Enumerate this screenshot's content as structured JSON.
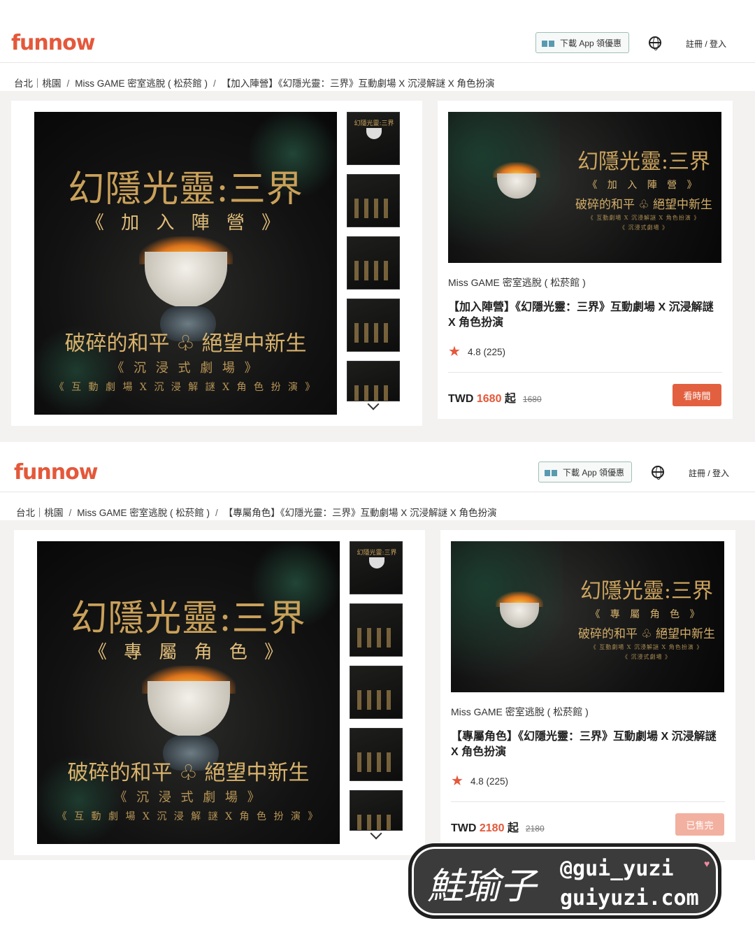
{
  "brand": {
    "logo_text": "funnow",
    "accent": "#e4583b"
  },
  "header": {
    "app_button_label": "下載 App 領優惠",
    "globe_icon": "globe-icon",
    "login_label": "註冊 / 登入"
  },
  "listings": [
    {
      "breadcrumb": {
        "city": "台北｜桃園",
        "venue": "Miss GAME 密室逃脫 ( 松菸館 )",
        "product": "【加入陣營】《幻隱光靈：三界》互動劇場 X 沉浸解謎 X 角色扮演"
      },
      "poster": {
        "title": "幻隱光靈:三界",
        "subtitle": "《 加 入 陣 營 》",
        "line3": "破碎的和平 ♧ 絕望中新生",
        "line4": "《 沉 浸 式 劇 場 》",
        "line5": "《 互 動 劇 場  X  沉 浸 解 謎  X  角 色 扮 演 》"
      },
      "info_art": {
        "title": "幻隱光靈:三界",
        "subtitle": "《 加 入 陣 營 》",
        "line3": "破碎的和平 ♧ 絕望中新生",
        "line4": "《 互動劇場 X 沉浸解謎 X 角色扮演 》",
        "line5": "《 沉浸式劇場 》"
      },
      "venue": "Miss GAME 密室逃脫 ( 松菸館 )",
      "title": "【加入陣營】《幻隱光靈：三界》互動劇場 X 沉浸解謎 X 角色扮演",
      "rating": "4.8 (225)",
      "price_prefix": "TWD ",
      "price": "1680",
      "price_suffix": " 起",
      "original_price": "1680",
      "button_label": "看時間",
      "button_state": "active"
    },
    {
      "breadcrumb": {
        "city": "台北｜桃園",
        "venue": "Miss GAME 密室逃脫 ( 松菸館 )",
        "product": "【專屬角色】《幻隱光靈：三界》互動劇場 X 沉浸解謎 X 角色扮演"
      },
      "poster": {
        "title": "幻隱光靈:三界",
        "subtitle": "《 專 屬 角 色 》",
        "line3": "破碎的和平 ♧ 絕望中新生",
        "line4": "《 沉 浸 式 劇 場 》",
        "line5": "《 互 動 劇 場  X  沉 浸 解 謎  X  角 色 扮 演 》"
      },
      "info_art": {
        "title": "幻隱光靈:三界",
        "subtitle": "《 專 屬 角 色 》",
        "line3": "破碎的和平 ♧ 絕望中新生",
        "line4": "《 互動劇場 X 沉浸解謎 X 角色扮演 》",
        "line5": "《 沉浸式劇場 》"
      },
      "venue": "Miss GAME 密室逃脫 ( 松菸館 )",
      "title": "【專屬角色】《幻隱光靈：三界》互動劇場 X 沉浸解謎 X 角色扮演",
      "rating": "4.8 (225)",
      "price_prefix": "TWD ",
      "price": "2180",
      "price_suffix": " 起",
      "original_price": "2180",
      "button_label": "已售完",
      "button_state": "soldout"
    }
  ],
  "thumbnails": [
    "幻隱光靈:三界",
    "",
    "",
    "",
    ""
  ],
  "watermark": {
    "signature": "鮭瑜子",
    "handle": "@gui_yuzi",
    "site": "guiyuzi.com"
  }
}
